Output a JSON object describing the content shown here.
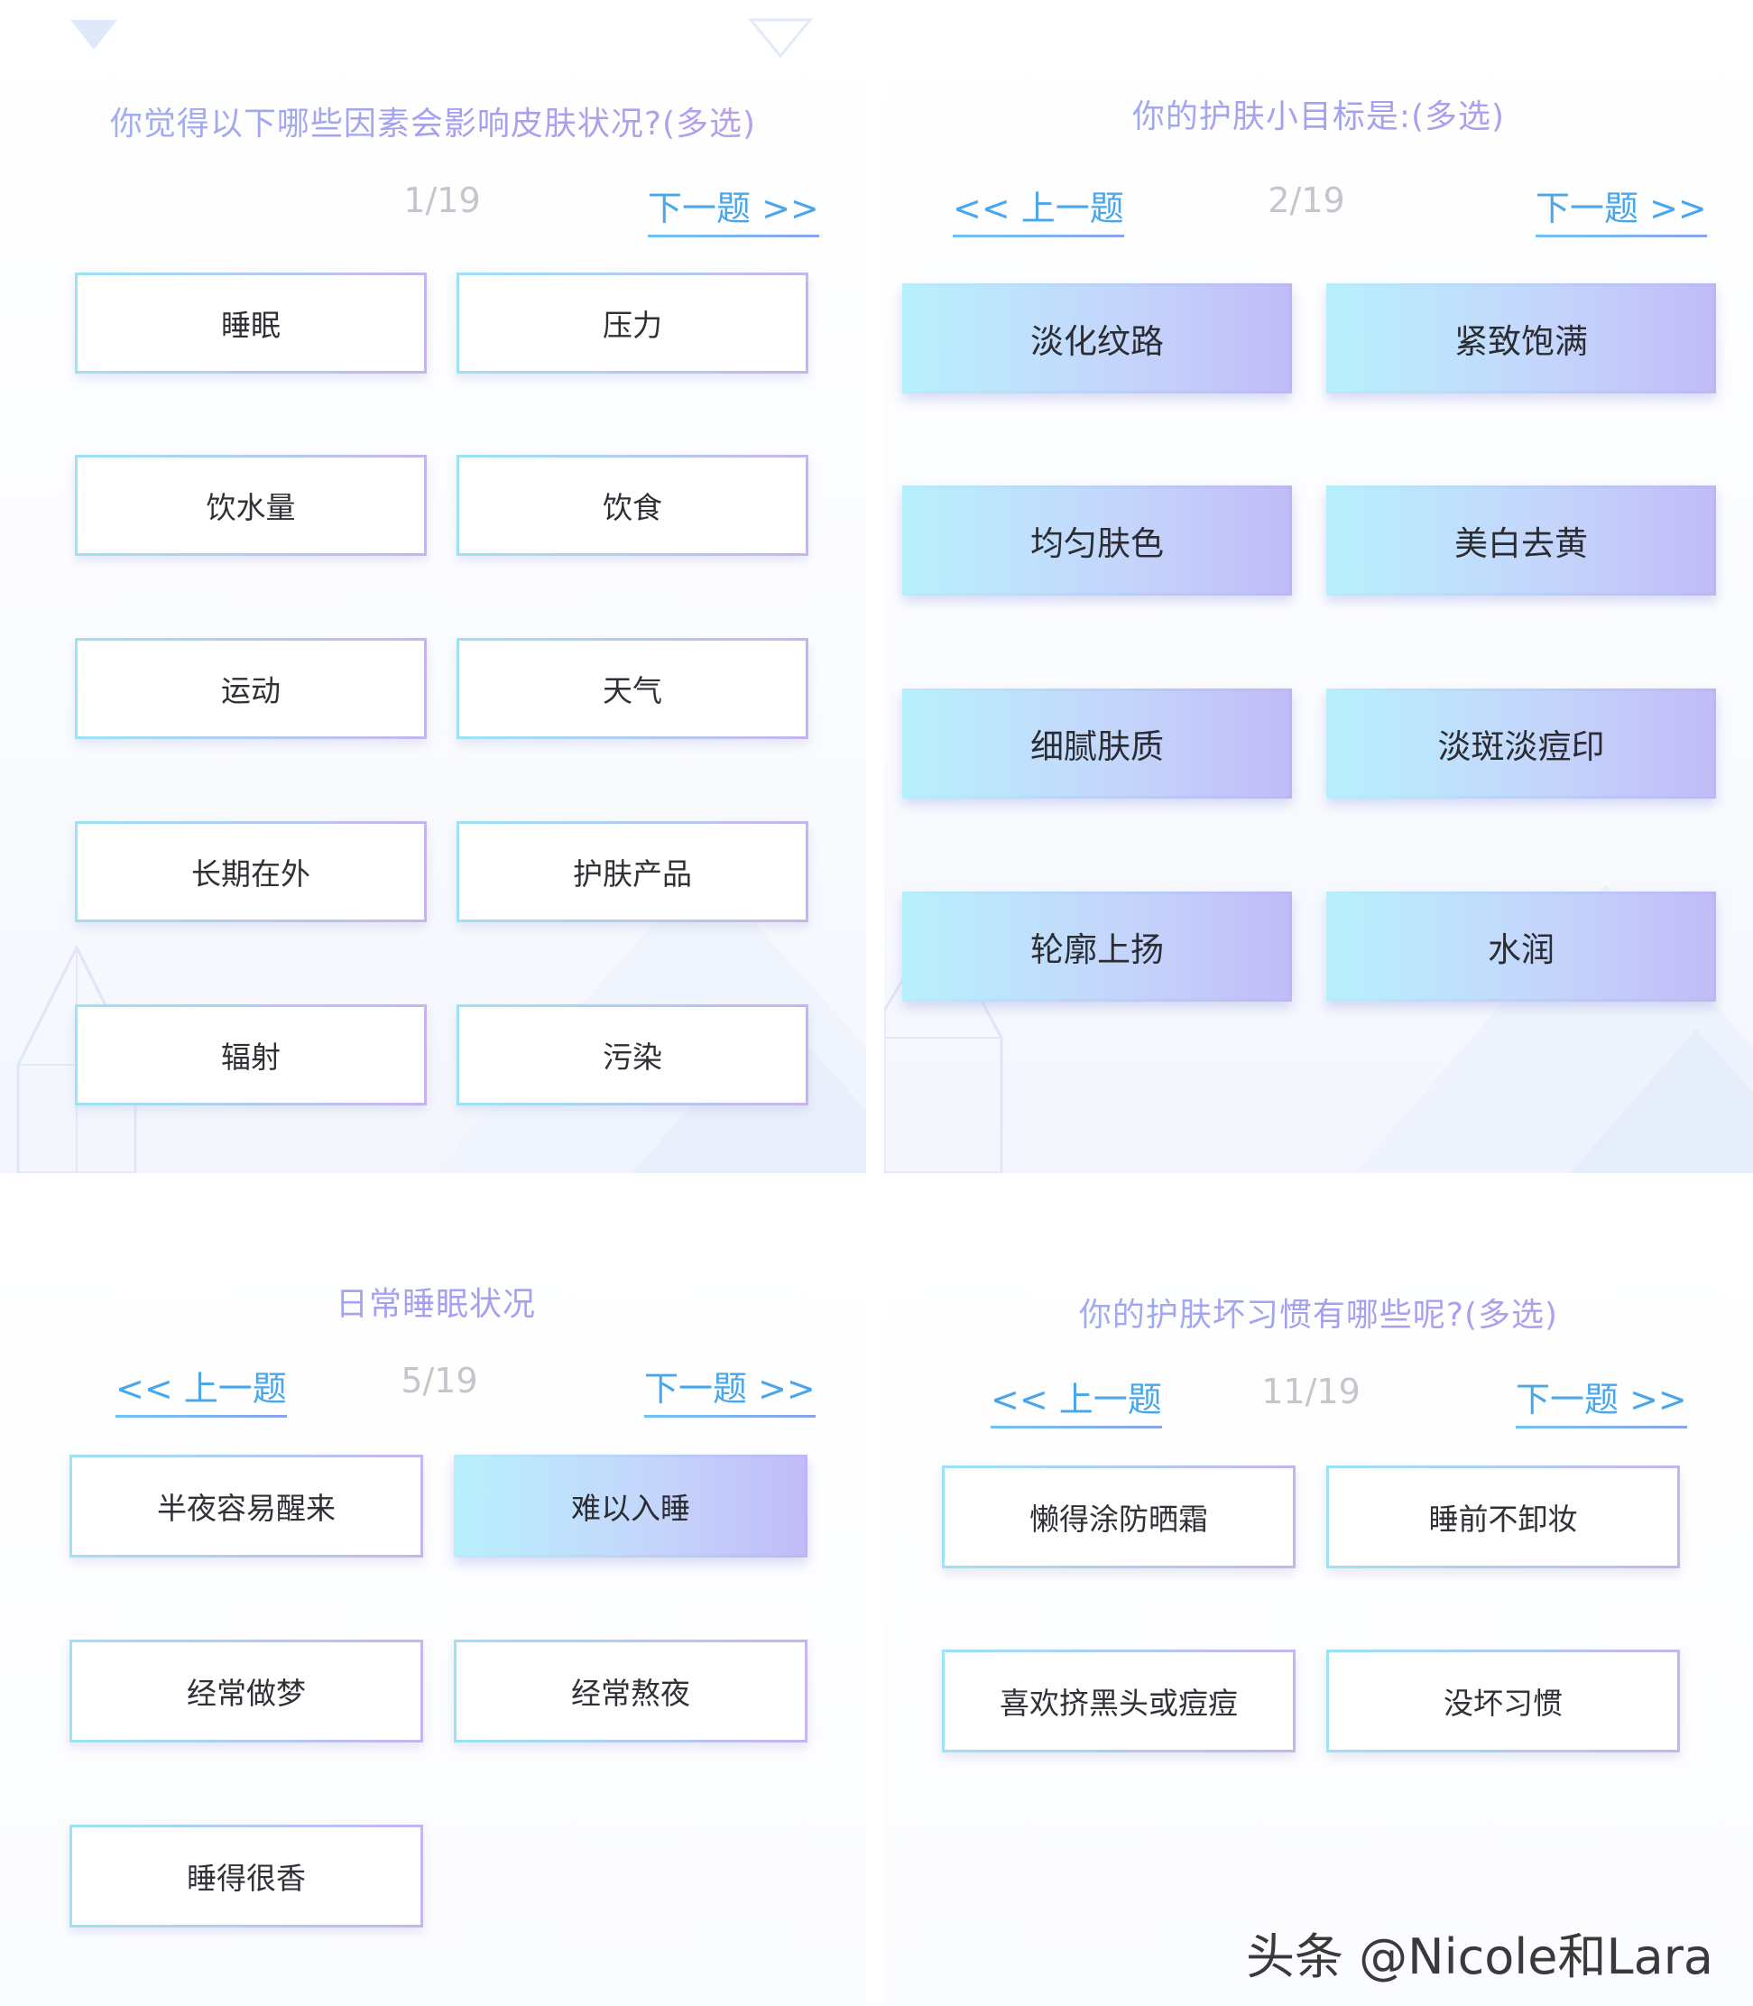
{
  "panels": {
    "p1": {
      "question": "你觉得以下哪些因素会影响皮肤状况?(多选)",
      "counter": "1/19",
      "next": "下一题 >>",
      "options": [
        "睡眠",
        "压力",
        "饮水量",
        "饮食",
        "运动",
        "天气",
        "长期在外",
        "护肤产品",
        "辐射",
        "污染"
      ],
      "selected": []
    },
    "p2": {
      "question": "你的护肤小目标是:(多选)",
      "counter": "2/19",
      "prev": "<< 上一题",
      "next": "下一题 >>",
      "options": [
        "淡化纹路",
        "紧致饱满",
        "均匀肤色",
        "美白去黄",
        "细腻肤质",
        "淡斑淡痘印",
        "轮廓上扬",
        "水润"
      ],
      "selected": [
        "淡化纹路",
        "紧致饱满",
        "均匀肤色",
        "美白去黄",
        "细腻肤质",
        "淡斑淡痘印",
        "轮廓上扬",
        "水润"
      ]
    },
    "p3": {
      "question": "日常睡眠状况",
      "counter": "5/19",
      "prev": "<< 上一题",
      "next": "下一题 >>",
      "options": [
        "半夜容易醒来",
        "难以入睡",
        "经常做梦",
        "经常熬夜",
        "睡得很香"
      ],
      "selected": [
        "难以入睡"
      ]
    },
    "p4": {
      "question": "你的护肤坏习惯有哪些呢?(多选)",
      "counter": "11/19",
      "prev": "<< 上一题",
      "next": "下一题 >>",
      "options": [
        "懒得涂防晒霜",
        "睡前不卸妆",
        "喜欢挤黑头或痘痘",
        "没坏习惯"
      ],
      "selected": []
    }
  },
  "watermark": "头条 @Nicole和Lara",
  "colors": {
    "nav_link": "#4aa6ea",
    "counter": "#c3c6cd",
    "title_gradient": [
      "#9fb3ef",
      "#bf9fe8"
    ],
    "selected_gradient": [
      "#b8f0fd",
      "#c1bcf8"
    ],
    "border_gradient": [
      "#9ce3f4",
      "#c6b5f0"
    ]
  }
}
